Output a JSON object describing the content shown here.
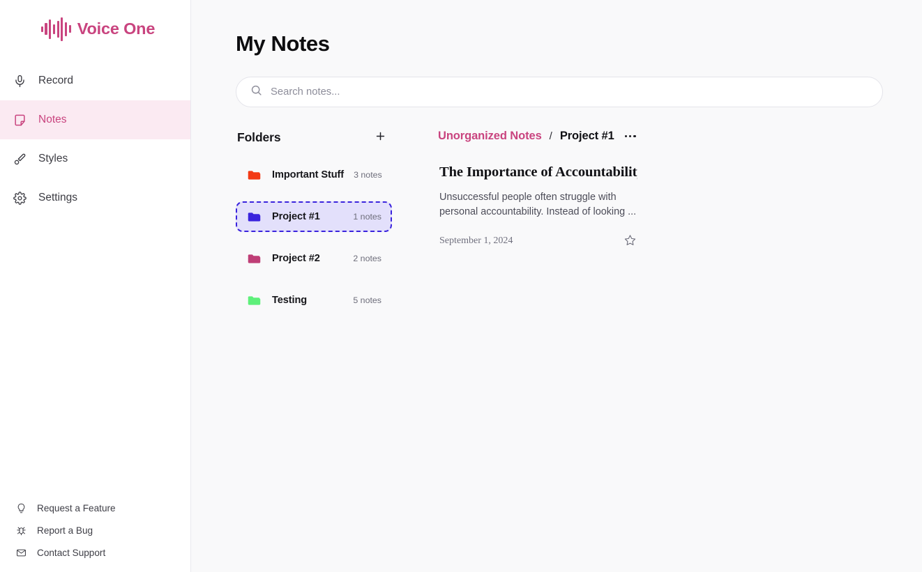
{
  "brand": {
    "name": "Voice One",
    "color": "#c9447f",
    "logo_icon": "audio-waveform-icon",
    "waveform_bars": [
      8,
      17,
      28,
      14,
      24,
      34,
      20,
      11
    ]
  },
  "sidebar": {
    "nav": [
      {
        "label": "Record",
        "icon": "microphone-icon",
        "active": false
      },
      {
        "label": "Notes",
        "icon": "note-icon",
        "active": true
      },
      {
        "label": "Styles",
        "icon": "paintbrush-icon",
        "active": false
      },
      {
        "label": "Settings",
        "icon": "gear-icon",
        "active": false
      }
    ],
    "footer": [
      {
        "label": "Request a Feature",
        "icon": "lightbulb-icon"
      },
      {
        "label": "Report a Bug",
        "icon": "bug-icon"
      },
      {
        "label": "Contact Support",
        "icon": "mail-icon"
      }
    ]
  },
  "main": {
    "title": "My Notes",
    "search": {
      "icon": "search-icon",
      "placeholder": "Search notes...",
      "value": ""
    },
    "folders": {
      "heading": "Folders",
      "add_icon": "plus-icon",
      "items": [
        {
          "name": "Important Stuff",
          "count": "3 notes",
          "color": "#f33a15",
          "selected": false
        },
        {
          "name": "Project #1",
          "count": "1 notes",
          "color": "#3a23dd",
          "selected": true
        },
        {
          "name": "Project #2",
          "count": "2 notes",
          "color": "#bf3e76",
          "selected": false
        },
        {
          "name": "Testing",
          "count": "5 notes",
          "color": "#5ef07a",
          "selected": false
        }
      ]
    },
    "breadcrumb": {
      "root": "Unorganized Notes",
      "separator": "/",
      "current": "Project #1",
      "menu_icon": "more-horizontal-icon"
    },
    "notes": [
      {
        "title": "The Importance of Accountability i...",
        "snippet": "Unsuccessful people often struggle with personal accountability. Instead of looking ...",
        "date": "September 1, 2024",
        "star_icon": "star-outline-icon",
        "starred": false
      }
    ]
  },
  "theme": {
    "accent": "#c9447f",
    "accent_bg": "#fbeaf2",
    "selected_folder_bg": "#e3e0fb",
    "selected_folder_border": "#3a23dd",
    "main_bg": "#f9f9fa",
    "sidebar_bg": "#ffffff"
  }
}
